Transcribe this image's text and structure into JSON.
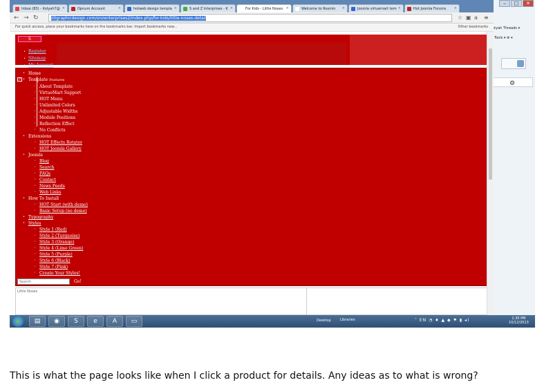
{
  "browser": {
    "tabs": [
      {
        "label": "Inbox (83) - itstyah7@",
        "color": "#d44"
      },
      {
        "label": "Opnum Account",
        "color": "#b22"
      },
      {
        "label": "hotweb design templa",
        "color": "#36c"
      },
      {
        "label": "S and Z Interprises - K",
        "color": "#4a4"
      },
      {
        "label": "For Kids - Little Noses",
        "color": "#fff"
      },
      {
        "label": "Welcome to Rosmin",
        "color": "#fff"
      },
      {
        "label": "Joomla virtuemart tem",
        "color": "#36c"
      },
      {
        "label": "Hot Joomla Forums",
        "color": "#b22"
      }
    ],
    "url": "zitgraphicdesign.com/snzenterprises2/index.php/for-kids/little-noses-detail",
    "apps_hint": "For quick access, place your bookmarks here on the bookmarks bar. Import bookmarks now...",
    "other_bookmarks": "Other bookmarks"
  },
  "page": {
    "logo_text": "S",
    "top_menu": [
      "Register",
      "Sitemap",
      "My Account"
    ],
    "menu": [
      {
        "level": 1,
        "label": "Home",
        "link": false
      },
      {
        "level": 1,
        "label": "Template",
        "link": false,
        "tooltip": "Features"
      },
      {
        "level": 2,
        "label": "About Template",
        "link": false
      },
      {
        "level": 2,
        "label": "VirtueMart Support",
        "link": false
      },
      {
        "level": 2,
        "label": "HOT Menu",
        "link": false
      },
      {
        "level": 2,
        "label": "Unlimited Colors",
        "link": false
      },
      {
        "level": 2,
        "label": "Adjustable Widths",
        "link": false
      },
      {
        "level": 2,
        "label": "Module Positions",
        "link": false
      },
      {
        "level": 2,
        "label": "Reflection Effect",
        "link": false
      },
      {
        "level": 2,
        "label": "No Conflicts",
        "link": false
      },
      {
        "level": 1,
        "label": "Extensions",
        "link": false
      },
      {
        "level": 2,
        "label": "HOT Effects Rotator",
        "link": true
      },
      {
        "level": 2,
        "label": "HOT Joomla Gallery",
        "link": true
      },
      {
        "level": 1,
        "label": "Joomla",
        "link": false
      },
      {
        "level": 2,
        "label": "Blog",
        "link": true
      },
      {
        "level": 2,
        "label": "Search",
        "link": true
      },
      {
        "level": 2,
        "label": "FAQs",
        "link": true
      },
      {
        "level": 2,
        "label": "Contact",
        "link": true
      },
      {
        "level": 2,
        "label": "News Feeds",
        "link": true
      },
      {
        "level": 2,
        "label": "Web Links",
        "link": true
      },
      {
        "level": 1,
        "label": "How To Install",
        "link": false
      },
      {
        "level": 2,
        "label": "HOT Start (with demo)",
        "link": true
      },
      {
        "level": 2,
        "label": "Basic Setup (no demo)",
        "link": true
      },
      {
        "level": 1,
        "label": "Typography",
        "link": true
      },
      {
        "level": 1,
        "label": "Styles",
        "link": true
      },
      {
        "level": 2,
        "label": "Style 1 (Red)",
        "link": true
      },
      {
        "level": 2,
        "label": "Style 2 (Turquoise)",
        "link": true
      },
      {
        "level": 2,
        "label": "Style 3 (Orange)",
        "link": true
      },
      {
        "level": 2,
        "label": "Style 4 (Lime Green)",
        "link": true
      },
      {
        "level": 2,
        "label": "Style 5 (Purple)",
        "link": true
      },
      {
        "level": 2,
        "label": "Style 6 (Black)",
        "link": true
      },
      {
        "level": 2,
        "label": "Style 7 (Pink)",
        "link": true
      },
      {
        "level": 2,
        "label": "Create Your Styles!",
        "link": true
      }
    ],
    "search_placeholder": "Search",
    "search_go": "Go!",
    "footer_text": "Little Noses"
  },
  "background_window": {
    "text1": "Itstyah Threads ▾",
    "text2": "Tools ▾ ⚙ ▾"
  },
  "taskbar": {
    "desktop_label": "Desktop",
    "libraries_label": "Libraries",
    "clock_time": "1:35 PM",
    "clock_date": "10/12/2013"
  },
  "caption": "This is what the page looks like when I click a product for details. Any ideas as to what is wrong?",
  "colors": {
    "page_red": "#c00000",
    "taskbar": "#2e4f74"
  }
}
